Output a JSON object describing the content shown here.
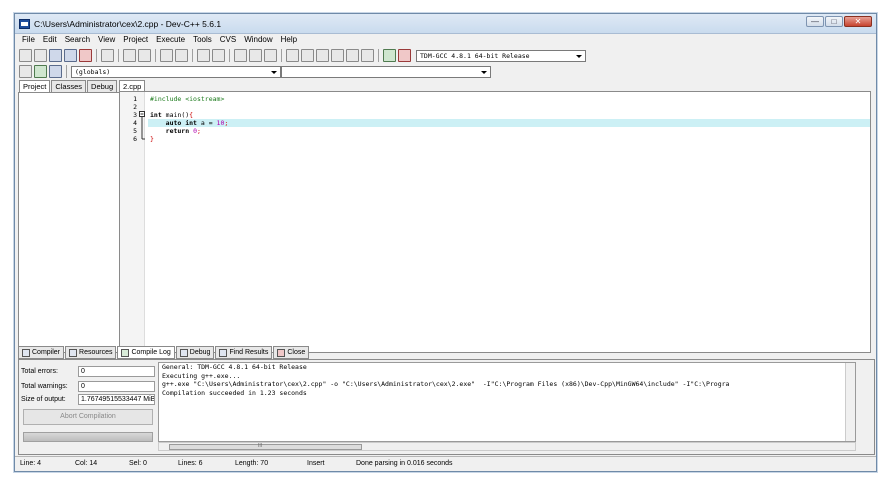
{
  "window": {
    "title": "C:\\Users\\Administrator\\cex\\2.cpp - Dev-C++ 5.6.1",
    "controls": {
      "minimize": "—",
      "maximize": "□",
      "close": "✕"
    }
  },
  "menu": [
    "File",
    "Edit",
    "Search",
    "View",
    "Project",
    "Execute",
    "Tools",
    "CVS",
    "Window",
    "Help"
  ],
  "toolbar": {
    "compiler_select": "TDM-GCC 4.8.1 64-bit Release",
    "scope_select": "(globals)",
    "function_select": "",
    "search_select": ""
  },
  "left_tabs": [
    "Project",
    "Classes",
    "Debug"
  ],
  "editor": {
    "tab_label": "2.cpp",
    "line_numbers": [
      "1",
      "2",
      "3",
      "4",
      "5",
      "6"
    ],
    "lines": {
      "l1": "#include <iostream>",
      "l3_kw": "int",
      "l3_rest": " main()",
      "l3_brace": "{",
      "l4_indent": "    ",
      "l4_kw": "auto int",
      "l4_rest": " a = ",
      "l4_num": "10",
      "l4_end": ";",
      "l5_indent": "    ",
      "l5_kw": "return",
      "l5_sp": " ",
      "l5_num": "0",
      "l5_end": ";",
      "l6_brace": "}"
    }
  },
  "bottom_tabs": {
    "compiler": "Compiler",
    "resources": "Resources",
    "compile_log": "Compile Log",
    "debug": "Debug",
    "find_results": "Find Results",
    "close": "Close"
  },
  "stats": {
    "total_errors_label": "Total errors:",
    "total_errors": "0",
    "total_warnings_label": "Total warnings:",
    "total_warnings": "0",
    "output_size_label": "Size of output:",
    "output_size": "1.76749515533447 MiB"
  },
  "abort_button": "Abort Compilation",
  "compile_log": [
    "General: TDM-GCC 4.8.1 64-bit Release",
    "Executing g++.exe...",
    "g++.exe \"C:\\Users\\Administrator\\cex\\2.cpp\" -o \"C:\\Users\\Administrator\\cex\\2.exe\"  -I\"C:\\Program Files (x86)\\Dev-Cpp\\MinGW64\\include\" -I\"C:\\Progra",
    "Compilation succeeded in 1.23 seconds"
  ],
  "scroll": {
    "hscroll_grip": "III"
  },
  "statusbar": {
    "line": "Line:   4",
    "col": "Col:   14",
    "sel": "Sel:   0",
    "lines": "Lines:   6",
    "length": "Length:   70",
    "mode": "Insert",
    "message": "Done parsing in 0.016 seconds"
  },
  "colors": {
    "current_line": "#ccf0f5",
    "preprocessor": "#1a7a1a",
    "number": "#b000b0",
    "brace": "#cc0000"
  }
}
